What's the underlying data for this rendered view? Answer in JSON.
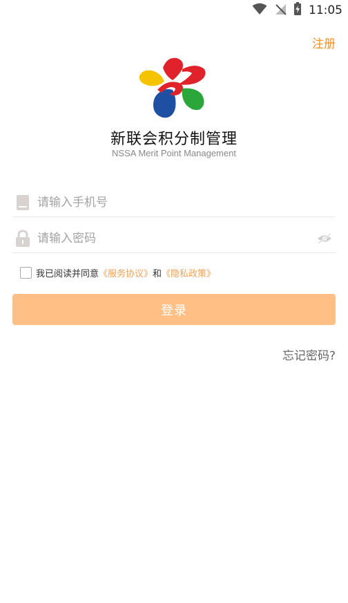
{
  "status_bar": {
    "time": "11:05",
    "icons": [
      "wifi-icon",
      "no-signal-icon",
      "battery-charging-icon"
    ]
  },
  "header": {
    "register_label": "注册"
  },
  "brand": {
    "logo_name": "nssa-star-logo",
    "title": "新联会积分制管理",
    "subtitle": "NSSA Merit Point Management"
  },
  "form": {
    "phone": {
      "placeholder": "请输入手机号",
      "value": "",
      "icon": "phone-icon"
    },
    "password": {
      "placeholder": "请输入密码",
      "value": "",
      "icon": "lock-icon",
      "toggle_icon": "eye-hidden-icon"
    },
    "agreement": {
      "checked": false,
      "prefix": "我已阅读并同意",
      "service_link": "《服务协议》",
      "conjunction": "和",
      "privacy_link": "《隐私政策》"
    },
    "login_label": "登录",
    "forgot_label": "忘记密码?"
  },
  "colors": {
    "accent": "#f28f2e",
    "button_bg": "#ffbf85",
    "link": "#f2a25a",
    "logo_red": "#e0232b",
    "logo_yellow": "#f5c400",
    "logo_blue": "#1d4fa3",
    "logo_green": "#2aa63a"
  }
}
